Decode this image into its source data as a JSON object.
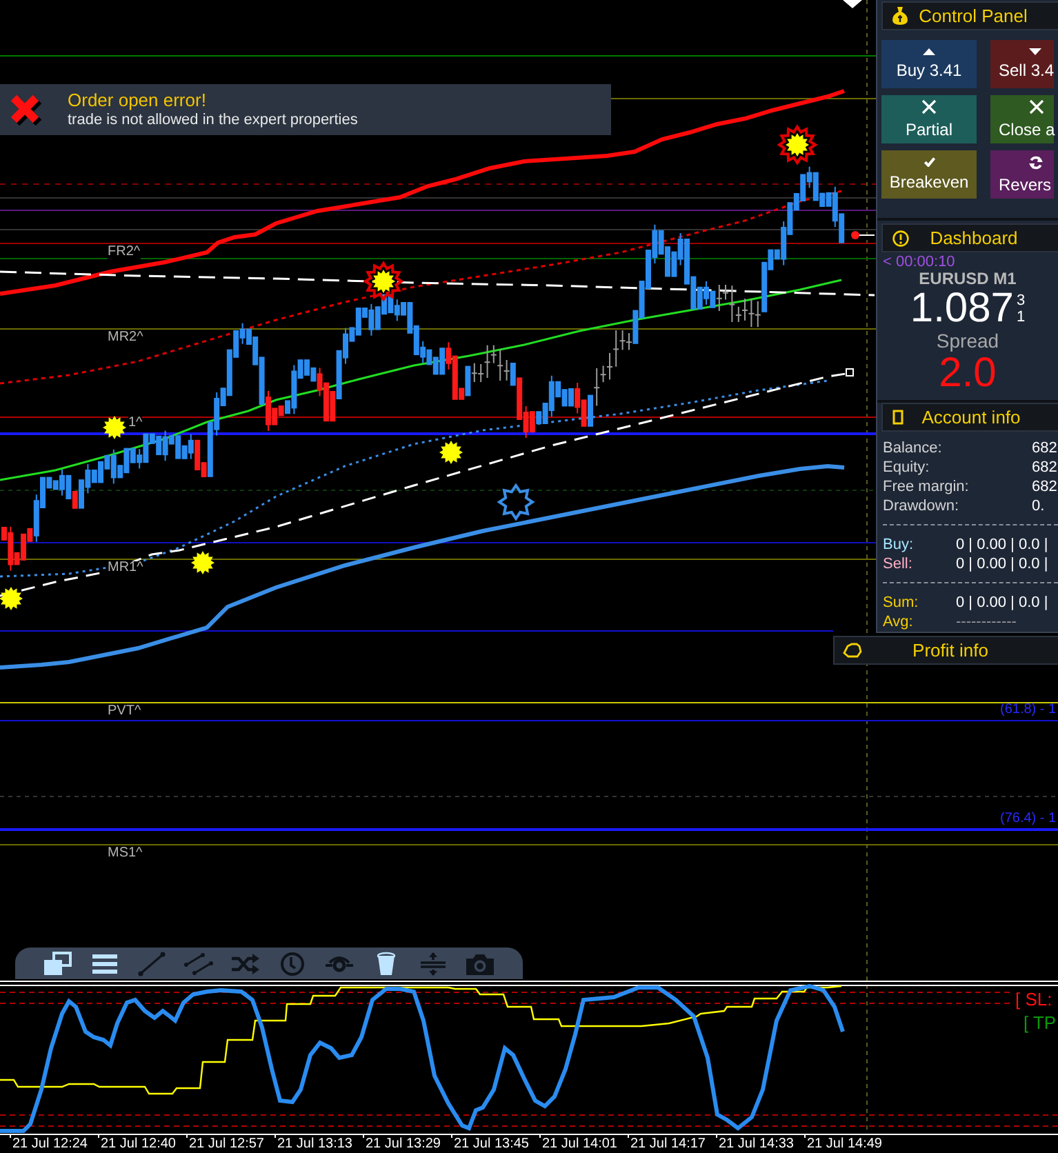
{
  "notification": {
    "title": "Order open error!",
    "message": "trade is not allowed in the expert properties"
  },
  "chart": {
    "level_labels": [
      "FR2^",
      "MR2^",
      "1^",
      "MR1^",
      "PVT^",
      "MS1^"
    ],
    "right_labels": [
      "(61.8) - 1",
      "(76.4) - 1"
    ]
  },
  "control_panel": {
    "title": "Control Panel",
    "buttons": [
      {
        "label": "Buy 3.41",
        "kind": "buy"
      },
      {
        "label": "Sell 3.4",
        "kind": "sell"
      },
      {
        "label": "Partial",
        "kind": "partial"
      },
      {
        "label": "Close a",
        "kind": "close"
      },
      {
        "label": "Breakeven",
        "kind": "breakeven"
      },
      {
        "label": "Revers",
        "kind": "reverse"
      }
    ]
  },
  "dashboard": {
    "title": "Dashboard",
    "countdown": "< 00:00:10",
    "symbol": "EURUSD M1",
    "price": "1.087",
    "price_digits": [
      "3",
      "1"
    ],
    "spread_label": "Spread",
    "spread": "2.0"
  },
  "account_info": {
    "title": "Account info",
    "rows": [
      {
        "label": "Balance:",
        "value": "682"
      },
      {
        "label": "Equity:",
        "value": "682"
      },
      {
        "label": "Free margin:",
        "value": "682"
      },
      {
        "label": "Drawdown:",
        "value": "0."
      }
    ],
    "positions": [
      {
        "label": "Buy:",
        "value": "0 | 0.00 | 0.0 |",
        "kind": "buy"
      },
      {
        "label": "Sell:",
        "value": "0 | 0.00 | 0.0 |",
        "kind": "sell"
      }
    ],
    "totals": [
      {
        "label": "Sum:",
        "value": "0 | 0.00 | 0.0 |",
        "kind": "sum"
      },
      {
        "label": "Avg:",
        "value": "------------",
        "kind": "average"
      }
    ]
  },
  "profit_info": {
    "title": "Profit info"
  },
  "toolbar": {
    "tools": [
      {
        "active": true
      },
      {
        "active": true
      },
      {
        "active": false
      },
      {
        "active": false
      },
      {
        "active": false
      },
      {
        "active": false
      },
      {
        "active": false
      },
      {
        "active": true
      },
      {
        "active": false
      },
      {
        "active": false
      }
    ]
  },
  "oscillator": {
    "labels": [
      {
        "text": "[ SL:",
        "kind": "sl"
      },
      {
        "text": "[ TP",
        "kind": "tp"
      }
    ]
  },
  "time_axis": {
    "labels": [
      "21 Jul 12:24",
      "21 Jul 12:40",
      "21 Jul 12:57",
      "21 Jul 13:13",
      "21 Jul 13:29",
      "21 Jul 13:45",
      "21 Jul 14:01",
      "21 Jul 14:17",
      "21 Jul 14:33",
      "21 Jul 14:49"
    ]
  }
}
